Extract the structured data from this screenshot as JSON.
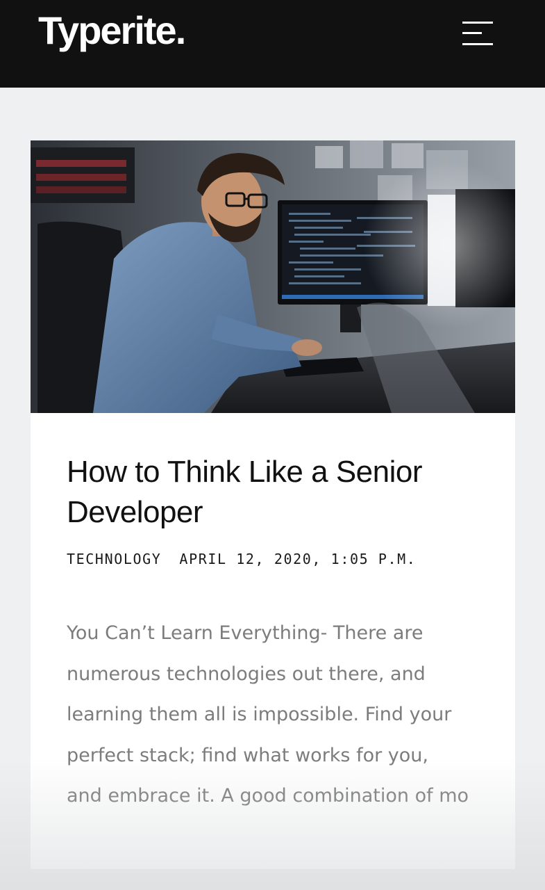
{
  "header": {
    "logo": "Typerite.",
    "menu_icon": "hamburger-menu-icon",
    "background": "#111111"
  },
  "article": {
    "image_description_icon": "photo",
    "title": "How to Think Like a Senior Developer",
    "category": "TECHNOLOGY",
    "date": "APRIL 12, 2020, 1:05 P.M.",
    "excerpt_lines": [
      "You Can’t Learn Everything- There are",
      "numerous technologies out there, and",
      "learning them all is impossible. Find your",
      "perfect stack; find what works for you,",
      "and embrace it. A good combination of mo"
    ]
  },
  "colors": {
    "page_background": "#eef0f2",
    "card_background": "#ffffff",
    "excerpt_text": "#7c7c7c"
  }
}
